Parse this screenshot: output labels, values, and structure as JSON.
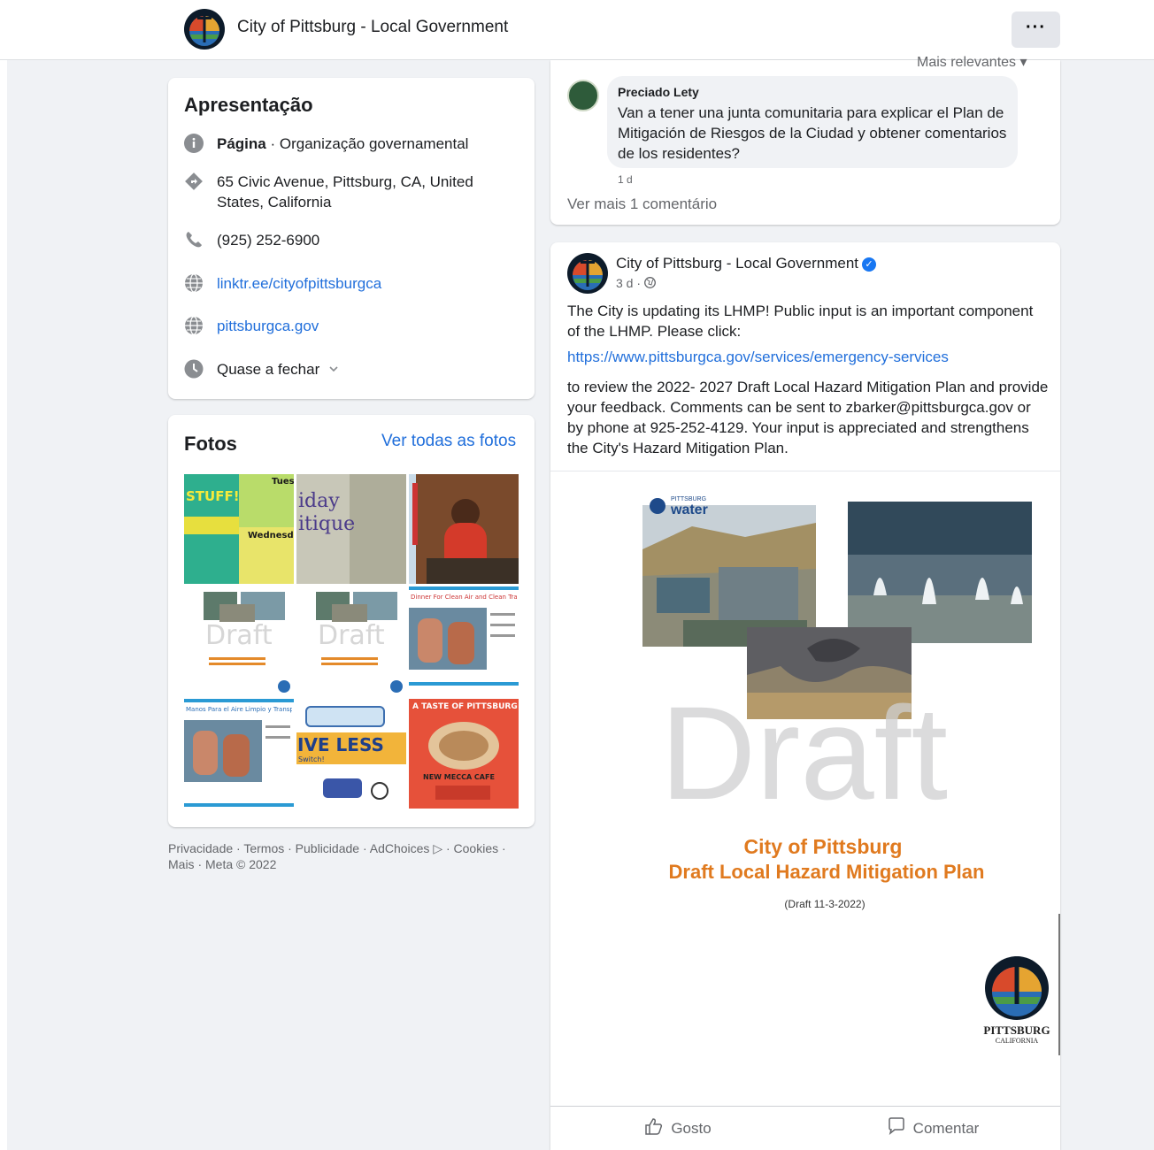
{
  "header": {
    "page_name": "City of Pittsburg - Local Government",
    "more_label": "···"
  },
  "intro": {
    "title": "Apresentação",
    "category_label": "Página",
    "category_value": " · Organização governamental",
    "address": "65 Civic Avenue, Pittsburg, CA, United States, California",
    "phone": "(925) 252-6900",
    "link1": "linktr.ee/cityofpittsburgca",
    "link2": "pittsburgca.gov",
    "hours": "Quase a fechar"
  },
  "photos": {
    "title": "Fotos",
    "see_all": "Ver todas as fotos",
    "tiles": [
      {
        "lines": [
          "STUFF!",
          "Tues",
          "Wednesda"
        ]
      },
      {
        "lines": [
          "iday",
          "itique"
        ]
      },
      {
        "lines": []
      },
      {
        "lines": [
          "Draft"
        ]
      },
      {
        "lines": [
          "Draft"
        ]
      },
      {
        "lines": [
          "Dinner For Clean Air and Clean Transp"
        ]
      },
      {
        "lines": [
          "Manos Para el Aire Limpio y Transport"
        ]
      },
      {
        "lines": [
          "IVE LESS",
          "Switch!"
        ]
      },
      {
        "lines": [
          "A TASTE OF PITTSBURG",
          "NEW MECCA CAFE"
        ]
      }
    ]
  },
  "footer": {
    "text": "Privacidade · Termos · Publicidade · AdChoices ▷ · Cookies · Mais · Meta © 2022"
  },
  "comment": {
    "sort_label": "Mais relevantes ▾",
    "author": "Preciado Lety",
    "text": "Van a tener una junta comunitaria para explicar el Plan de Mitigación de Riesgos de la Ciudad y obtener comentarios de los residentes?",
    "time": "1 d",
    "more_comments": "Ver mais 1 comentário"
  },
  "post": {
    "author": "City of Pittsburg - Local Government",
    "meta": "3 d ·",
    "text1": "The City is updating its LHMP! Public input is an important component of the LHMP. Please click:",
    "link": "https://www.pittsburgca.gov/services/emergency-services",
    "text2": "to review the 2022- 2027 Draft Local Hazard Mitigation Plan and provide your feedback. Comments can be sent to zbarker@pittsburgca.gov or by phone at 925-252-4129. Your input is appreciated and strengthens the City's Hazard Mitigation Plan.",
    "image": {
      "brand": "PITTSBURG",
      "brand_sub": "water",
      "watermark": "Draft",
      "title1": "City of Pittsburg",
      "title2": "Draft Local Hazard Mitigation Plan",
      "subtitle": "(Draft 11-3-2022)",
      "logo_text1": "PITTSBURG",
      "logo_text2": "CALIFORNIA"
    },
    "like_label": "Gosto",
    "comment_label": "Comentar"
  },
  "colors": {
    "link": "#216fdb",
    "accent_orange": "#e07a1f",
    "verified": "#1877f2"
  }
}
